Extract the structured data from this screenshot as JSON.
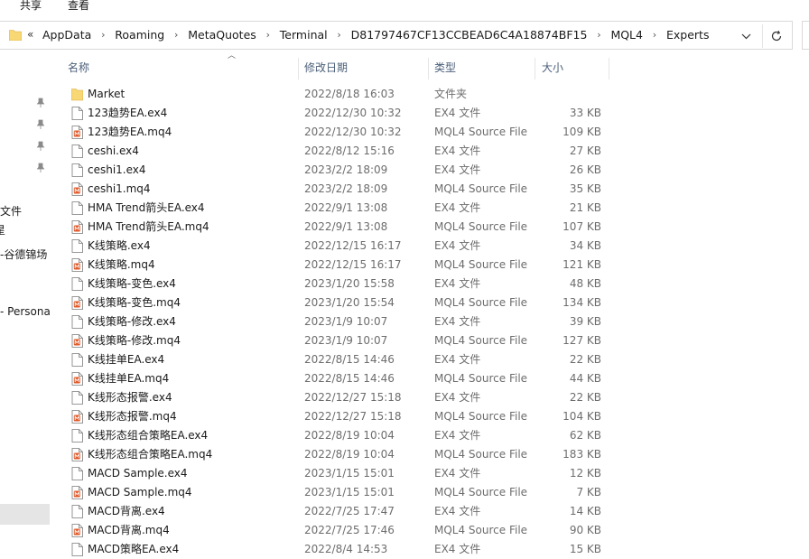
{
  "ribbon": {
    "tabs": [
      "共享",
      "查看"
    ]
  },
  "address_bar": {
    "overflow": "«",
    "crumbs": [
      "AppData",
      "Roaming",
      "MetaQuotes",
      "Terminal",
      "D81797467CF13CCBEAD6C4A18874BF15",
      "MQL4",
      "Experts"
    ],
    "separator": "›"
  },
  "sidebar": {
    "labels": [
      "文件",
      "星",
      "-谷德锦场",
      "- Persona"
    ]
  },
  "columns": {
    "name": "名称",
    "date": "修改日期",
    "type": "类型",
    "size": "大小"
  },
  "files": [
    {
      "name": "Market",
      "date": "2022/8/18 16:03",
      "type": "文件夹",
      "size": "",
      "icon": "folder-icon"
    },
    {
      "name": "123趋势EA.ex4",
      "date": "2022/12/30 10:32",
      "type": "EX4 文件",
      "size": "33 KB",
      "icon": "file-icon"
    },
    {
      "name": "123趋势EA.mq4",
      "date": "2022/12/30 10:32",
      "type": "MQL4 Source File",
      "size": "109 KB",
      "icon": "mq4-file-icon"
    },
    {
      "name": "ceshi.ex4",
      "date": "2022/8/12 15:16",
      "type": "EX4 文件",
      "size": "27 KB",
      "icon": "file-icon"
    },
    {
      "name": "ceshi1.ex4",
      "date": "2023/2/2 18:09",
      "type": "EX4 文件",
      "size": "26 KB",
      "icon": "file-icon"
    },
    {
      "name": "ceshi1.mq4",
      "date": "2023/2/2 18:09",
      "type": "MQL4 Source File",
      "size": "35 KB",
      "icon": "mq4-file-icon"
    },
    {
      "name": "HMA Trend箭头EA.ex4",
      "date": "2022/9/1 13:08",
      "type": "EX4 文件",
      "size": "21 KB",
      "icon": "file-icon"
    },
    {
      "name": "HMA Trend箭头EA.mq4",
      "date": "2022/9/1 13:08",
      "type": "MQL4 Source File",
      "size": "107 KB",
      "icon": "mq4-file-icon"
    },
    {
      "name": "K线策略.ex4",
      "date": "2022/12/15 16:17",
      "type": "EX4 文件",
      "size": "34 KB",
      "icon": "file-icon"
    },
    {
      "name": "K线策略.mq4",
      "date": "2022/12/15 16:17",
      "type": "MQL4 Source File",
      "size": "121 KB",
      "icon": "mq4-file-icon"
    },
    {
      "name": "K线策略-变色.ex4",
      "date": "2023/1/20 15:58",
      "type": "EX4 文件",
      "size": "48 KB",
      "icon": "file-icon"
    },
    {
      "name": "K线策略-变色.mq4",
      "date": "2023/1/20 15:54",
      "type": "MQL4 Source File",
      "size": "134 KB",
      "icon": "mq4-file-icon"
    },
    {
      "name": "K线策略-修改.ex4",
      "date": "2023/1/9 10:07",
      "type": "EX4 文件",
      "size": "39 KB",
      "icon": "file-icon"
    },
    {
      "name": "K线策略-修改.mq4",
      "date": "2023/1/9 10:07",
      "type": "MQL4 Source File",
      "size": "127 KB",
      "icon": "mq4-file-icon"
    },
    {
      "name": "K线挂单EA.ex4",
      "date": "2022/8/15 14:46",
      "type": "EX4 文件",
      "size": "22 KB",
      "icon": "file-icon"
    },
    {
      "name": "K线挂单EA.mq4",
      "date": "2022/8/15 14:46",
      "type": "MQL4 Source File",
      "size": "44 KB",
      "icon": "mq4-file-icon"
    },
    {
      "name": "K线形态报警.ex4",
      "date": "2022/12/27 15:18",
      "type": "EX4 文件",
      "size": "22 KB",
      "icon": "file-icon"
    },
    {
      "name": "K线形态报警.mq4",
      "date": "2022/12/27 15:18",
      "type": "MQL4 Source File",
      "size": "104 KB",
      "icon": "mq4-file-icon"
    },
    {
      "name": "K线形态组合策略EA.ex4",
      "date": "2022/8/19 10:04",
      "type": "EX4 文件",
      "size": "62 KB",
      "icon": "file-icon"
    },
    {
      "name": "K线形态组合策略EA.mq4",
      "date": "2022/8/19 10:04",
      "type": "MQL4 Source File",
      "size": "183 KB",
      "icon": "mq4-file-icon"
    },
    {
      "name": "MACD Sample.ex4",
      "date": "2023/1/15 15:01",
      "type": "EX4 文件",
      "size": "12 KB",
      "icon": "file-icon"
    },
    {
      "name": "MACD Sample.mq4",
      "date": "2023/1/15 15:01",
      "type": "MQL4 Source File",
      "size": "7 KB",
      "icon": "mq4-file-icon"
    },
    {
      "name": "MACD背离.ex4",
      "date": "2022/7/25 17:47",
      "type": "EX4 文件",
      "size": "14 KB",
      "icon": "file-icon"
    },
    {
      "name": "MACD背离.mq4",
      "date": "2022/7/25 17:46",
      "type": "MQL4 Source File",
      "size": "90 KB",
      "icon": "mq4-file-icon"
    },
    {
      "name": "MACD策略EA.ex4",
      "date": "2022/8/4 14:53",
      "type": "EX4 文件",
      "size": "15 KB",
      "icon": "file-icon"
    }
  ],
  "colors": {
    "header_text": "#4c607a",
    "meta_text": "#6d6d6d",
    "folder": "#f8d775",
    "mq4_accent": "#e05a2b"
  }
}
